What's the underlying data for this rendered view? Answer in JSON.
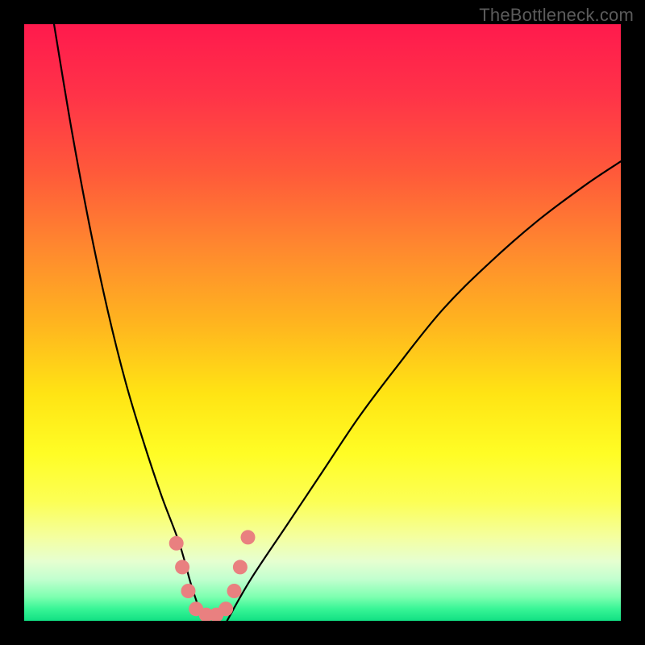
{
  "watermark": "TheBottleneck.com",
  "gradient": {
    "stops": [
      {
        "offset": 0.0,
        "color": "#ff1a4d"
      },
      {
        "offset": 0.12,
        "color": "#ff3348"
      },
      {
        "offset": 0.25,
        "color": "#ff5a3a"
      },
      {
        "offset": 0.38,
        "color": "#ff8a2e"
      },
      {
        "offset": 0.5,
        "color": "#ffb41f"
      },
      {
        "offset": 0.62,
        "color": "#ffe414"
      },
      {
        "offset": 0.72,
        "color": "#fffd25"
      },
      {
        "offset": 0.8,
        "color": "#fcff55"
      },
      {
        "offset": 0.86,
        "color": "#f4ffa0"
      },
      {
        "offset": 0.9,
        "color": "#e6ffd0"
      },
      {
        "offset": 0.93,
        "color": "#c2ffcf"
      },
      {
        "offset": 0.96,
        "color": "#7dffb0"
      },
      {
        "offset": 0.98,
        "color": "#38f596"
      },
      {
        "offset": 1.0,
        "color": "#11e083"
      }
    ]
  },
  "chart_data": {
    "type": "line",
    "title": "",
    "xlabel": "",
    "ylabel": "",
    "x_range": [
      0,
      100
    ],
    "y_range": [
      0,
      100
    ],
    "optimum_x": 30,
    "series": [
      {
        "name": "left-branch",
        "x": [
          5,
          8,
          11,
          14,
          17,
          20,
          23,
          26,
          28,
          30
        ],
        "y": [
          100,
          82,
          66,
          52,
          40,
          30,
          21,
          13,
          6,
          0
        ]
      },
      {
        "name": "right-branch",
        "x": [
          34,
          38,
          44,
          50,
          56,
          62,
          70,
          78,
          86,
          94,
          100
        ],
        "y": [
          0,
          7,
          16,
          25,
          34,
          42,
          52,
          60,
          67,
          73,
          77
        ]
      }
    ],
    "markers": {
      "name": "highlight-dots",
      "color": "#e98080",
      "points": [
        {
          "x": 25.5,
          "y": 13
        },
        {
          "x": 26.5,
          "y": 9
        },
        {
          "x": 27.5,
          "y": 5
        },
        {
          "x": 28.8,
          "y": 2
        },
        {
          "x": 30.5,
          "y": 1
        },
        {
          "x": 32.2,
          "y": 1
        },
        {
          "x": 33.8,
          "y": 2
        },
        {
          "x": 35.2,
          "y": 5
        },
        {
          "x": 36.2,
          "y": 9
        },
        {
          "x": 37.5,
          "y": 14
        }
      ]
    }
  }
}
